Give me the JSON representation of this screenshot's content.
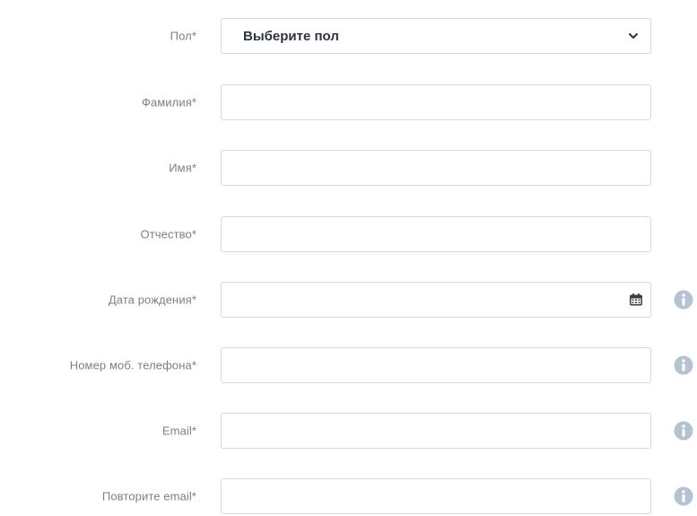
{
  "form": {
    "gender": {
      "label": "Пол*",
      "selected": "Выберите пол"
    },
    "last_name": {
      "label": "Фамилия*",
      "value": ""
    },
    "first_name": {
      "label": "Имя*",
      "value": ""
    },
    "patronymic": {
      "label": "Отчество*",
      "value": ""
    },
    "birth_date": {
      "label": "Дата рождения*",
      "value": "",
      "icon": "calendar-icon"
    },
    "phone": {
      "label": "Номер моб. телефона*",
      "value": ""
    },
    "email": {
      "label": "Email*",
      "value": ""
    },
    "email_repeat": {
      "label": "Повторите email*",
      "value": ""
    }
  },
  "colors": {
    "label": "#7b7f87",
    "border": "#d6d9de",
    "info_icon": "#b3c3d2",
    "select_text": "#2d3540"
  }
}
